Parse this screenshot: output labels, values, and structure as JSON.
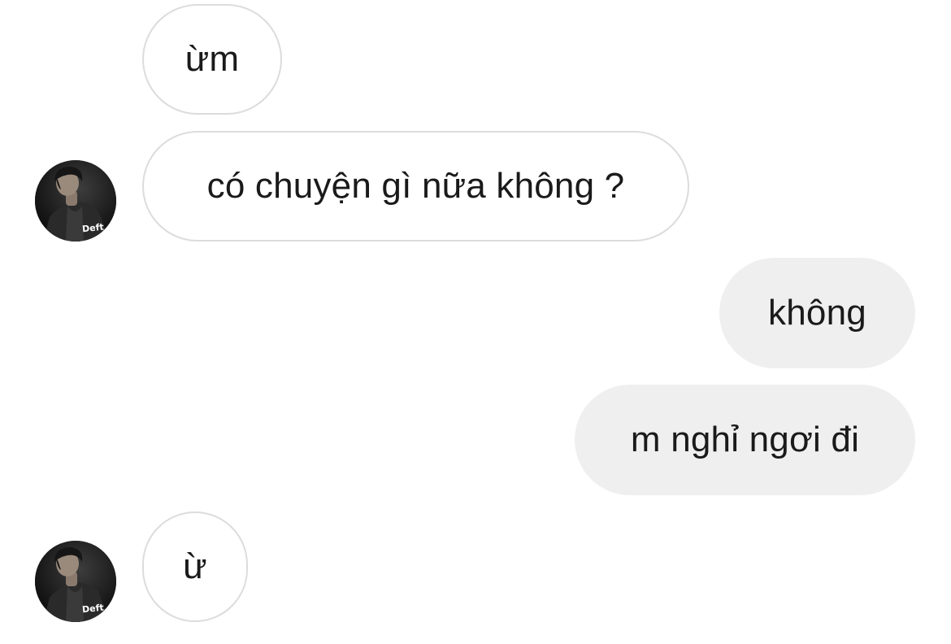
{
  "conversation": {
    "messages": [
      {
        "sender": "other",
        "text": "ừm",
        "show_avatar": false
      },
      {
        "sender": "other",
        "text": "có chuyện gì nữa không ?",
        "show_avatar": true
      },
      {
        "sender": "me",
        "text": "không"
      },
      {
        "sender": "me",
        "text": "m nghỉ ngơi đi"
      },
      {
        "sender": "other",
        "text": "ừ",
        "show_avatar": true
      }
    ],
    "contact": {
      "avatar_caption": "Deft"
    }
  },
  "colors": {
    "incoming_bg": "#ffffff",
    "incoming_border": "#dcdcdc",
    "outgoing_bg": "#efefef",
    "text": "#1a1a1a"
  },
  "icons": {
    "avatar": "profile-photo"
  }
}
